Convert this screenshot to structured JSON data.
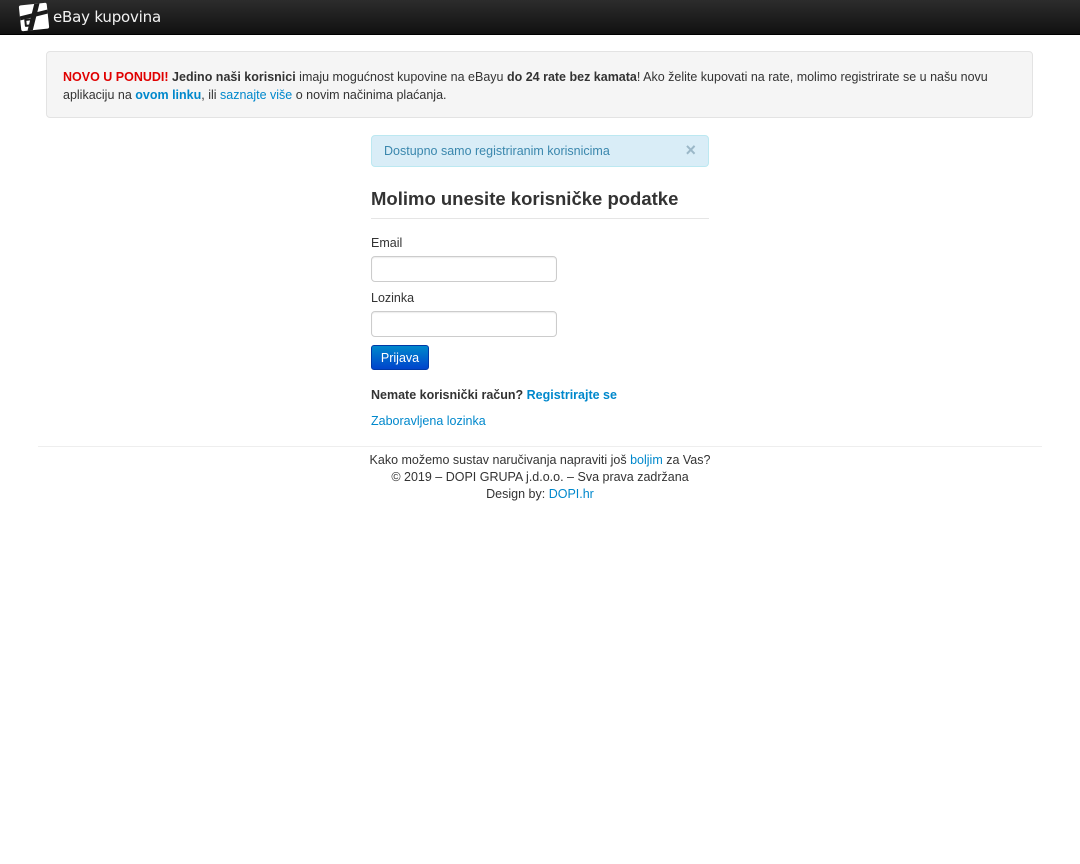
{
  "navbar": {
    "brand_text": "eBay kupovina",
    "logo_icon": "gift-box-icon"
  },
  "promo": {
    "highlight": "NOVO U PONUDI!",
    "bold1": "Jedino naši korisnici",
    "text1": " imaju mogućnost kupovine na eBayu ",
    "bold2": "do 24 rate bez kamata",
    "text2": "! Ako želite kupovati na rate, molimo registrirate se u našu novu aplikaciju na ",
    "link1": "ovom linku",
    "text3": ", ili ",
    "link2": "saznajte više",
    "text4": " o novim načinima plaćanja."
  },
  "alert": {
    "text": "Dostupno samo registriranim korisnicima",
    "close": "×"
  },
  "login": {
    "title": "Molimo unesite korisničke podatke",
    "email_label": "Email",
    "email_value": "",
    "password_label": "Lozinka",
    "password_value": "",
    "submit_label": "Prijava",
    "no_account_text": "Nemate korisnički račun?",
    "register_link": "Registrirajte se",
    "forgot_link": "Zaboravljena lozinka"
  },
  "footer": {
    "line1_before": "Kako možemo sustav naručivanja napraviti još ",
    "line1_link": "boljim",
    "line1_after": " za Vas?",
    "copyright": "© 2019 – DOPI GRUPA j.d.o.o. – Sva prava zadržana",
    "design_label": "Design by: ",
    "design_link": "DOPI.hr"
  },
  "colors": {
    "link": "#0088cc",
    "highlight_red": "#e00000",
    "alert_bg": "#d9edf7",
    "navbar_bg": "#1b1b1b",
    "button_primary": "#0055cc"
  }
}
